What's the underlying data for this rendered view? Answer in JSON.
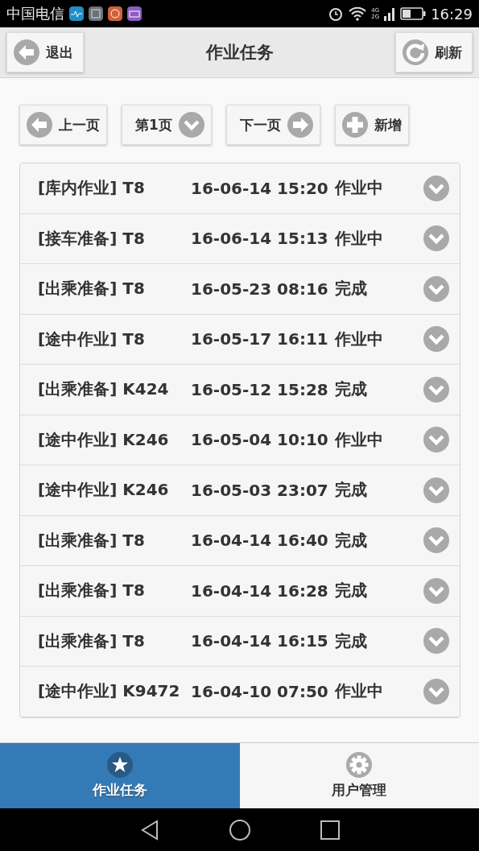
{
  "status_bar": {
    "carrier": "中国电信",
    "network_top": "4G",
    "network_bottom": "2G",
    "time": "16:29"
  },
  "header": {
    "back_button": "退出",
    "title": "作业任务",
    "refresh_button": "刷新"
  },
  "toolbar": [
    {
      "kind": "prev",
      "label": "上一页"
    },
    {
      "kind": "page",
      "label": "第1页"
    },
    {
      "kind": "next",
      "label": "下一页"
    },
    {
      "kind": "add",
      "label": "新增"
    }
  ],
  "tasks": [
    {
      "title": "[库内作业] T8",
      "time": "16-06-14 15:20",
      "status": "作业中"
    },
    {
      "title": "[接车准备] T8",
      "time": "16-06-14 15:13",
      "status": "作业中"
    },
    {
      "title": "[出乘准备] T8",
      "time": "16-05-23 08:16",
      "status": "完成"
    },
    {
      "title": "[途中作业] T8",
      "time": "16-05-17 16:11",
      "status": "作业中"
    },
    {
      "title": "[出乘准备] K424",
      "time": "16-05-12 15:28",
      "status": "完成"
    },
    {
      "title": "[途中作业] K246",
      "time": "16-05-04 10:10",
      "status": "作业中"
    },
    {
      "title": "[途中作业] K246",
      "time": "16-05-03 23:07",
      "status": "完成"
    },
    {
      "title": "[出乘准备] T8",
      "time": "16-04-14 16:40",
      "status": "完成"
    },
    {
      "title": "[出乘准备] T8",
      "time": "16-04-14 16:28",
      "status": "完成"
    },
    {
      "title": "[出乘准备] T8",
      "time": "16-04-14 16:15",
      "status": "完成"
    },
    {
      "title": "[途中作业] K9472",
      "time": "16-04-10 07:50",
      "status": "作业中"
    }
  ],
  "tab_bar": [
    {
      "kind": "star",
      "label": "作业任务",
      "selected": true
    },
    {
      "kind": "gear",
      "label": "用户管理",
      "selected": false
    }
  ]
}
